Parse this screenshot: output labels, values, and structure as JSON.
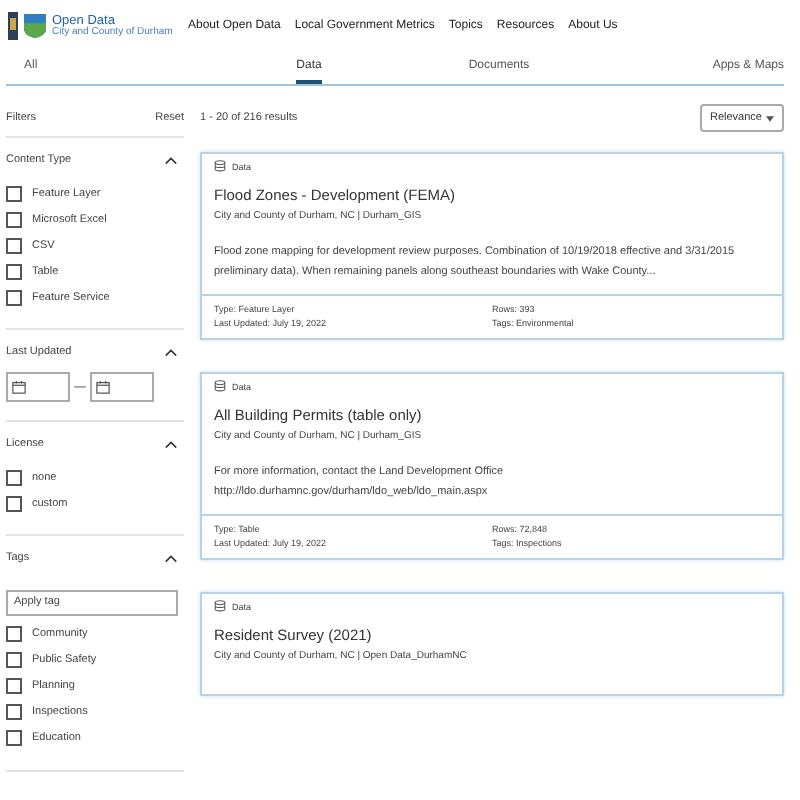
{
  "header": {
    "logo_title": "Open Data",
    "logo_subtitle": "City and County of Durham",
    "nav": [
      "About Open Data",
      "Local Government Metrics",
      "Topics",
      "Resources",
      "About Us"
    ]
  },
  "tabs": [
    {
      "label": "All",
      "selected": false
    },
    {
      "label": "Data",
      "selected": true
    },
    {
      "label": "Documents",
      "selected": false
    },
    {
      "label": "Apps & Maps",
      "selected": false
    }
  ],
  "filters": {
    "title": "Filters",
    "reset": "Reset",
    "sections": [
      {
        "kind": "checkboxes",
        "title": "Content Type",
        "expanded": true,
        "options": [
          {
            "label": "Feature Layer",
            "checked": false
          },
          {
            "label": "Microsoft Excel",
            "checked": false
          },
          {
            "label": "CSV",
            "checked": false
          },
          {
            "label": "Table",
            "checked": false
          },
          {
            "label": "Feature Service",
            "checked": false
          }
        ]
      },
      {
        "kind": "dates",
        "title": "Last Updated",
        "expanded": true,
        "separator": "—"
      },
      {
        "kind": "checkboxes",
        "title": "License",
        "expanded": true,
        "options": [
          {
            "label": "none",
            "checked": false
          },
          {
            "label": "custom",
            "checked": false
          }
        ]
      },
      {
        "kind": "tags",
        "title": "Tags",
        "expanded": true,
        "placeholder": "Apply tag",
        "options": [
          {
            "label": "Community",
            "checked": false
          },
          {
            "label": "Public Safety",
            "checked": false
          },
          {
            "label": "Planning",
            "checked": false
          },
          {
            "label": "Inspections",
            "checked": false
          },
          {
            "label": "Education",
            "checked": false
          }
        ]
      }
    ]
  },
  "results": {
    "count": "1 - 20 of 216 results",
    "sort": "Relevance",
    "items": [
      {
        "kind_label": "Data",
        "title": "Flood Zones - Development (FEMA)",
        "org": "City and County of Durham, NC | Durham_GIS",
        "description": "Flood zone mapping for development review purposes. Combination of 10/19/2018 effective and 3/31/2015 preliminary data). When remaining panels along southeast boundaries with Wake County...",
        "type": "Type: Feature Layer",
        "updated": "Last Updated: July 19, 2022",
        "rows": "Rows: 393",
        "tags": "Tags: Environmental"
      },
      {
        "kind_label": "Data",
        "title": "All Building Permits (table only)",
        "org": "City and County of Durham, NC | Durham_GIS",
        "description": "For more information, contact the Land Development Office http://ldo.durhamnc.gov/durham/ldo_web/ldo_main.aspx",
        "type": "Type: Table",
        "updated": "Last Updated: July 19, 2022",
        "rows": "Rows: 72,848",
        "tags": "Tags: Inspections"
      },
      {
        "kind_label": "Data",
        "title": "Resident Survey (2021)",
        "org": "City and County of Durham, NC | Open Data_DurhamNC"
      }
    ]
  }
}
